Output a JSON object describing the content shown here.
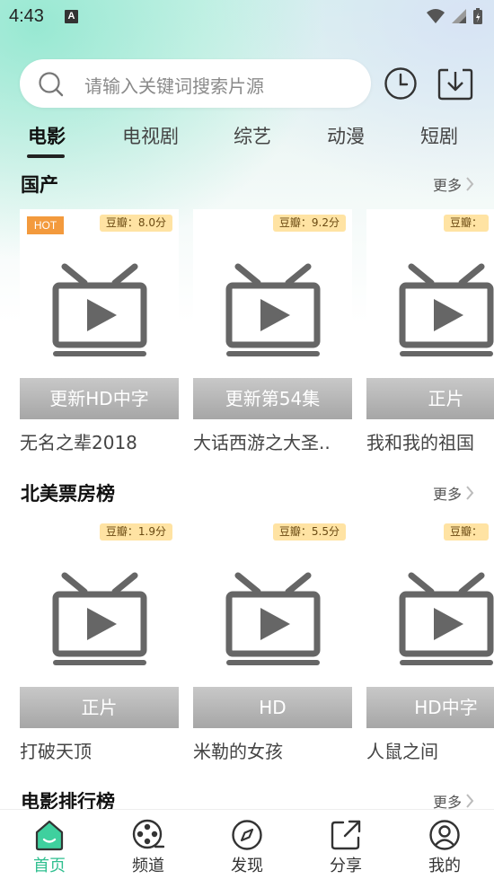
{
  "status_bar": {
    "time": "4:43",
    "notification_letter": "A"
  },
  "search": {
    "placeholder": "请输入关键词搜索片源"
  },
  "tabs": [
    {
      "label": "电影",
      "active": true
    },
    {
      "label": "电视剧",
      "active": false
    },
    {
      "label": "综艺",
      "active": false
    },
    {
      "label": "动漫",
      "active": false
    },
    {
      "label": "短剧",
      "active": false
    }
  ],
  "sections": [
    {
      "title": "国产",
      "more": "更多",
      "cards": [
        {
          "hot": "HOT",
          "rating": "豆瓣：8.0分",
          "caption": "更新HD中字",
          "title": "无名之辈2018"
        },
        {
          "rating": "豆瓣：9.2分",
          "caption": "更新第54集",
          "title": "大话西游之大圣.."
        },
        {
          "rating": "豆瓣：",
          "caption": "正片",
          "title": "我和我的祖国"
        }
      ]
    },
    {
      "title": "北美票房榜",
      "more": "更多",
      "cards": [
        {
          "rating": "豆瓣：1.9分",
          "caption": "正片",
          "title": "打破天顶"
        },
        {
          "rating": "豆瓣：5.5分",
          "caption": "HD",
          "title": "米勒的女孩"
        },
        {
          "rating": "豆瓣：",
          "caption": "HD中字",
          "title": "人鼠之间"
        }
      ]
    },
    {
      "title": "电影排行榜",
      "more": "更多"
    }
  ],
  "bottom_nav": [
    {
      "label": "首页",
      "icon": "home-icon",
      "active": true
    },
    {
      "label": "频道",
      "icon": "film-reel-icon",
      "active": false
    },
    {
      "label": "发现",
      "icon": "compass-icon",
      "active": false
    },
    {
      "label": "分享",
      "icon": "share-icon",
      "active": false
    },
    {
      "label": "我的",
      "icon": "user-icon",
      "active": false
    }
  ],
  "colors": {
    "accent": "#2fbf8f",
    "rating_badge_bg": "#ffe3a3",
    "hot_badge_bg": "#f39a3d",
    "caption_bar": "#b0b0b0"
  }
}
